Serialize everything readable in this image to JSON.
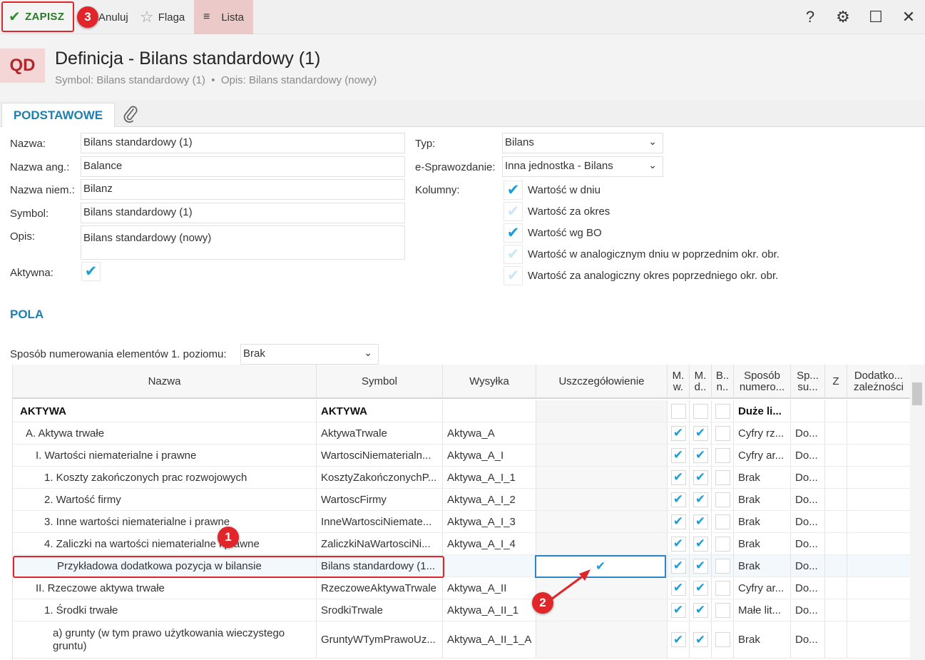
{
  "toolbar": {
    "save_label": "ZAPISZ",
    "cancel_label": "Anuluj",
    "flag_label": "Flaga",
    "list_label": "Lista"
  },
  "window_controls": {
    "help": "?",
    "settings": "⚙",
    "maximize": "☐",
    "close": "✕"
  },
  "header": {
    "logo": "QD",
    "title": "Definicja - Bilans standardowy (1)",
    "subtitle": "Symbol: Bilans standardowy (1)  •  Opis: Bilans standardowy (nowy)"
  },
  "tabs": {
    "basic": "PODSTAWOWE",
    "attach_icon": "paperclip-icon"
  },
  "form": {
    "nazwa_label": "Nazwa:",
    "nazwa": "Bilans standardowy (1)",
    "nazwa_ang_label": "Nazwa ang.:",
    "nazwa_ang": "Balance",
    "nazwa_niem_label": "Nazwa niem.:",
    "nazwa_niem": "Bilanz",
    "symbol_label": "Symbol:",
    "symbol": "Bilans standardowy (1)",
    "opis_label": "Opis:",
    "opis": "Bilans standardowy (nowy)",
    "aktywna_label": "Aktywna:",
    "typ_label": "Typ:",
    "typ": "Bilans",
    "esprawozdanie_label": "e-Sprawozdanie:",
    "esprawozdanie": "Inna jednostka - Bilans",
    "kolumny_label": "Kolumny:",
    "kolumny": [
      {
        "label": "Wartość w dniu",
        "checked": true
      },
      {
        "label": "Wartość za okres",
        "checked": false
      },
      {
        "label": "Wartość wg BO",
        "checked": true
      },
      {
        "label": "Wartość w analogicznym dniu w poprzednim okr. obr.",
        "checked": false
      },
      {
        "label": "Wartość za analogiczny okres poprzedniego okr. obr.",
        "checked": false
      }
    ]
  },
  "pola": {
    "section_title": "POLA",
    "numbering_label": "Sposób numerowania elementów 1. poziomu:",
    "numbering_value": "Brak",
    "headers": [
      "Nazwa",
      "Symbol",
      "Wysyłka",
      "Uszczegółowienie",
      "M. w.",
      "M. d..",
      "B.. n..",
      "Sposób numero...",
      "Sp... su...",
      "Z",
      "Dodatko... zależności"
    ],
    "rows": [
      {
        "nazwa": "AKTYWA",
        "symbol": "AKTYWA",
        "wysylka": "",
        "sposob": "Duże li...",
        "sp": ""
      },
      {
        "nazwa": "A. Aktywa trwałe",
        "symbol": "AktywaTrwale",
        "wysylka": "Aktywa_A",
        "sposob": "Cyfry rz...",
        "sp": "Do..."
      },
      {
        "nazwa": "I. Wartości niematerialne i prawne",
        "symbol": "WartosciNiematerialn...",
        "wysylka": "Aktywa_A_I",
        "sposob": "Cyfry ar...",
        "sp": "Do..."
      },
      {
        "nazwa": "1. Koszty zakończonych prac rozwojowych",
        "symbol": "KosztyZakończonychP...",
        "wysylka": "Aktywa_A_I_1",
        "sposob": "Brak",
        "sp": "Do..."
      },
      {
        "nazwa": "2. Wartość firmy",
        "symbol": "WartoscFirmy",
        "wysylka": "Aktywa_A_I_2",
        "sposob": "Brak",
        "sp": "Do..."
      },
      {
        "nazwa": "3. Inne wartości niematerialne i prawne",
        "symbol": "InneWartosciNiemate...",
        "wysylka": "Aktywa_A_I_3",
        "sposob": "Brak",
        "sp": "Do..."
      },
      {
        "nazwa": "4. Zaliczki na wartości niematerialne i prawne",
        "symbol": "ZaliczkiNaWartosciNi...",
        "wysylka": "Aktywa_A_I_4",
        "sposob": "Brak",
        "sp": "Do..."
      },
      {
        "nazwa": "Przykładowa dodatkowa pozycja w bilansie",
        "symbol": "Bilans standardowy (1...",
        "wysylka": "",
        "sposob": "Brak",
        "sp": "Do..."
      },
      {
        "nazwa": "II. Rzeczowe aktywa trwałe",
        "symbol": "RzeczoweAktywaTrwale",
        "wysylka": "Aktywa_A_II",
        "sposob": "Cyfry ar...",
        "sp": "Do..."
      },
      {
        "nazwa": "1. Środki trwałe",
        "symbol": "SrodkiTrwale",
        "wysylka": "Aktywa_A_II_1",
        "sposob": "Małe lit...",
        "sp": "Do..."
      },
      {
        "nazwa": "a) grunty (w tym prawo użytkowania wieczystego gruntu)",
        "symbol": "GruntyWTymPrawoUz...",
        "wysylka": "Aktywa_A_II_1_A",
        "sposob": "Brak",
        "sp": "Do..."
      }
    ]
  },
  "annotations": {
    "badge1": "1",
    "badge2": "2",
    "badge3": "3"
  },
  "colors": {
    "accent": "#1f7fae",
    "check": "#1a9dd9",
    "highlight": "#e0262a",
    "save": "#2a7a2a"
  }
}
